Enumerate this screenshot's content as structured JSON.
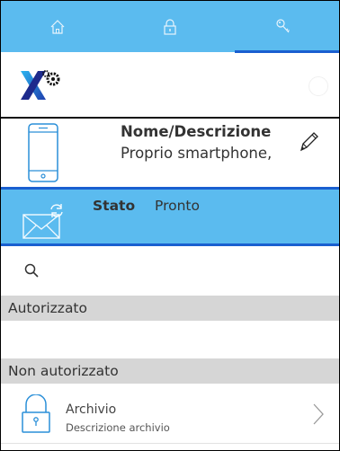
{
  "tabs": [
    {
      "name": "home-icon",
      "label": ""
    },
    {
      "name": "lock-icon",
      "label": ""
    },
    {
      "name": "key-icon",
      "label": ""
    }
  ],
  "colors": {
    "bar": "#5bbbef",
    "accent": "#1a5fd0"
  },
  "device": {
    "name_label": "Nome/Descrizione",
    "name_value": "Proprio smartphone,"
  },
  "status": {
    "label": "Stato",
    "value": "Pronto"
  },
  "search": {
    "placeholder": "",
    "value": ""
  },
  "sections": {
    "authorized": "Autorizzato",
    "not_authorized": "Non autorizzato"
  },
  "items": [
    {
      "title": "Archivio",
      "subtitle": "Descrizione archivio"
    }
  ]
}
